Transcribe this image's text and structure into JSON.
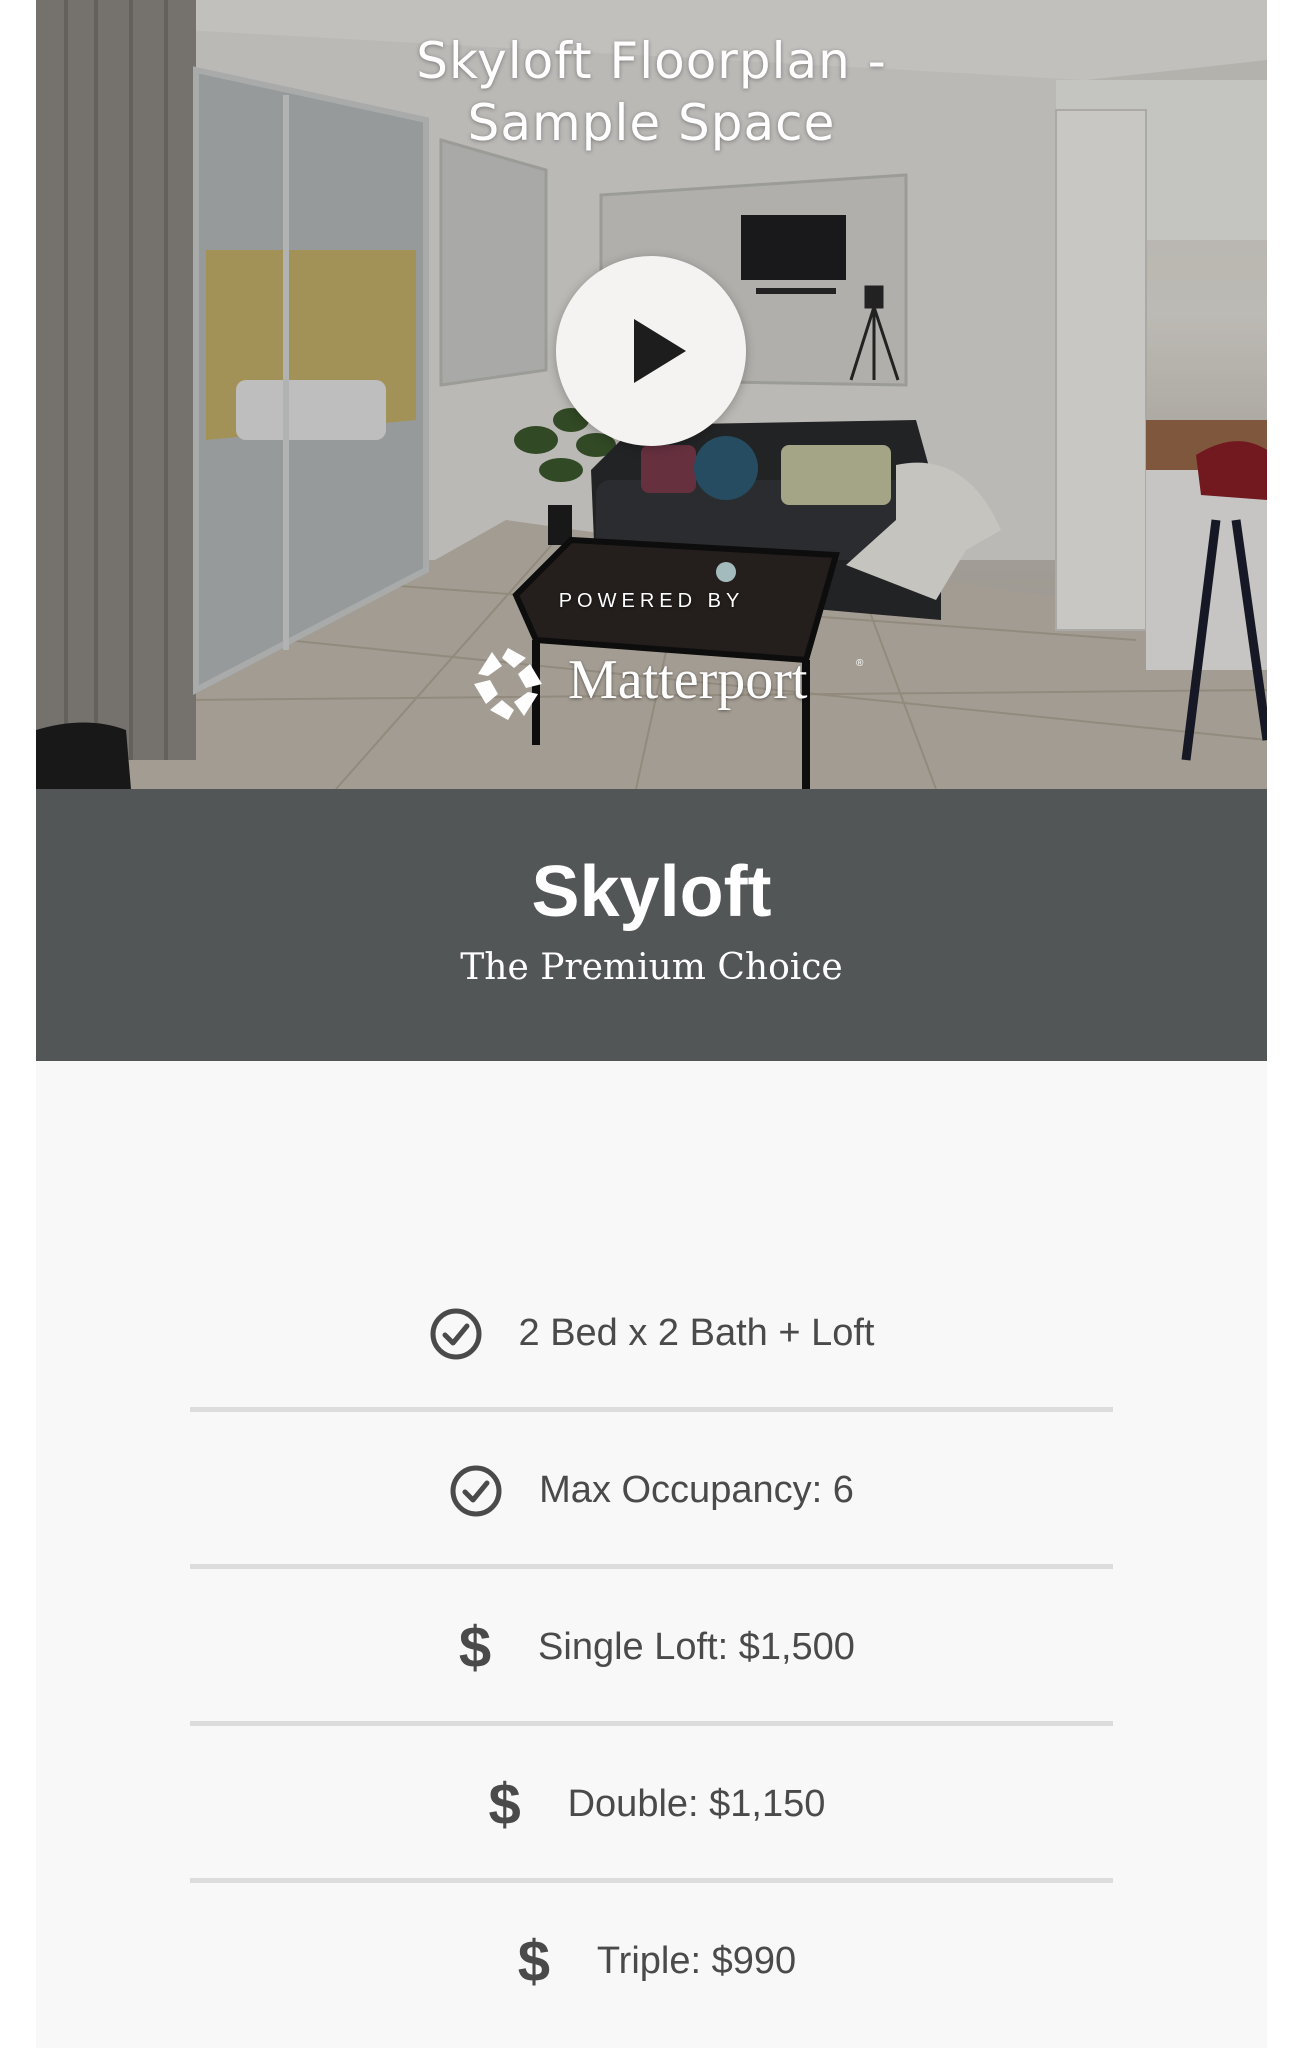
{
  "tour": {
    "title": "Skyloft Floorplan - Sample Space",
    "powered_by": "POWERED BY",
    "brand": "Matterport",
    "brand_mark": "®"
  },
  "header": {
    "title": "Skyloft",
    "subtitle": "The Premium Choice"
  },
  "features": [
    {
      "icon": "check-circle-icon",
      "text": "2 Bed x 2 Bath + Loft"
    },
    {
      "icon": "check-circle-icon",
      "text": "Max Occupancy: 6"
    },
    {
      "icon": "dollar-icon",
      "text": "Single Loft: $1,500"
    },
    {
      "icon": "dollar-icon",
      "text": "Double: $1,150"
    },
    {
      "icon": "dollar-icon",
      "text": "Triple: $990"
    }
  ],
  "dollar_glyph": "$"
}
